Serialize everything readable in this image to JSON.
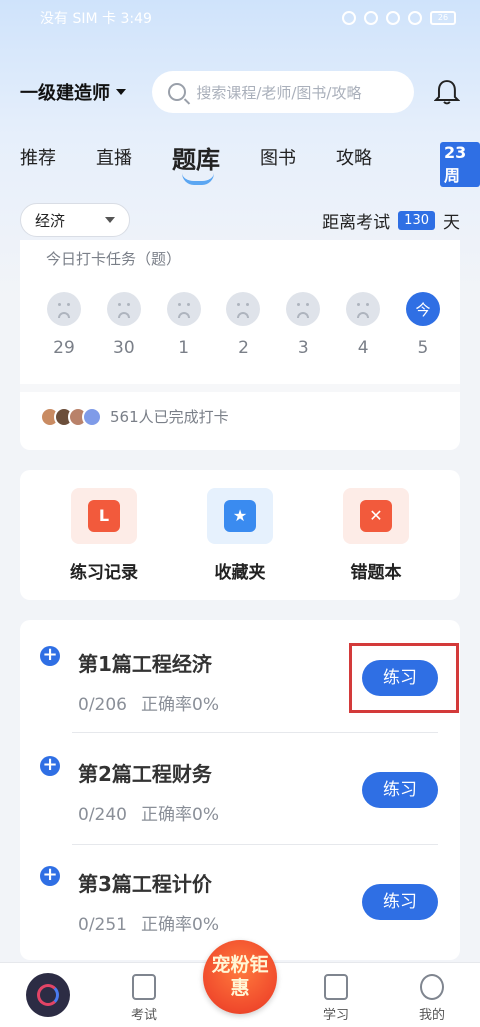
{
  "status_bar": {
    "left_text": "没有 SIM 卡 3:49",
    "battery": "26"
  },
  "header": {
    "exam": "一级建造师",
    "search_placeholder": "搜索课程/老师/图书/攻略"
  },
  "tabs": [
    "推荐",
    "直播",
    "题库",
    "图书",
    "攻略"
  ],
  "active_tab": "题库",
  "week_badge": "23周",
  "filter": {
    "subject": "经济",
    "countdown_prefix": "距离考试",
    "countdown_days": "130",
    "countdown_suffix": "天"
  },
  "checkin": {
    "title": "今日打卡任务（题）",
    "days": [
      {
        "num": "29",
        "face": "sad"
      },
      {
        "num": "30",
        "face": "sad"
      },
      {
        "num": "1",
        "face": "sad"
      },
      {
        "num": "2",
        "face": "sad"
      },
      {
        "num": "3",
        "face": "sad"
      },
      {
        "num": "4",
        "face": "sad"
      },
      {
        "num": "5",
        "face": "today",
        "label": "今"
      }
    ],
    "completed_text": "561人已完成打卡"
  },
  "tools": [
    {
      "label": "练习记录",
      "icon": "practice-record-icon",
      "color": "#f25a3c",
      "bg": "#fdece7"
    },
    {
      "label": "收藏夹",
      "icon": "favorites-icon",
      "color": "#3a8bf0",
      "bg": "#e6f1fd"
    },
    {
      "label": "错题本",
      "icon": "wrong-questions-icon",
      "color": "#f25a3c",
      "bg": "#fdece7"
    }
  ],
  "chapters": [
    {
      "title": "第1篇工程经济",
      "progress": "0/206",
      "accuracy": "正确率0%",
      "button": "练习"
    },
    {
      "title": "第2篇工程财务",
      "progress": "0/240",
      "accuracy": "正确率0%",
      "button": "练习"
    },
    {
      "title": "第3篇工程计价",
      "progress": "0/251",
      "accuracy": "正确率0%",
      "button": "练习"
    }
  ],
  "bottom_nav": {
    "exam": "考试",
    "promo": "宠粉钜惠",
    "study": "学习",
    "mine": "我的"
  },
  "colors": {
    "accent": "#2f6fe4",
    "highlight": "#d33a3a"
  }
}
